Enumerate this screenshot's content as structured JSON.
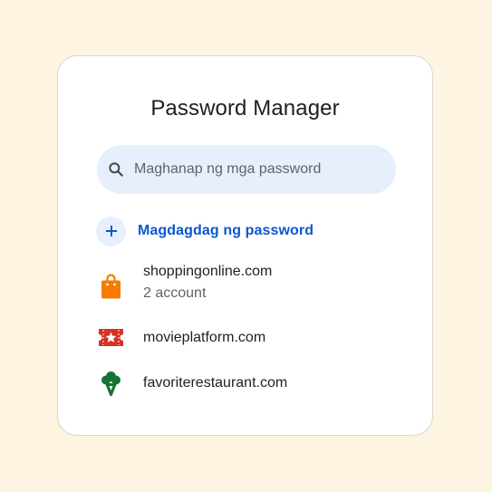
{
  "header": {
    "title": "Password Manager"
  },
  "search": {
    "placeholder": "Maghanap ng mga password",
    "value": ""
  },
  "add_password": {
    "label": "Magdagdag ng password"
  },
  "passwords": [
    {
      "site": "shoppingonline.com",
      "detail": "2 account",
      "icon": "shopping-bag-icon",
      "color": "#f57c00"
    },
    {
      "site": "movieplatform.com",
      "icon": "movie-ticket-icon",
      "color": "#d93025"
    },
    {
      "site": "favoriterestaurant.com",
      "icon": "broccoli-icon",
      "color": "#137333"
    }
  ],
  "colors": {
    "page_background": "#fdf4e1",
    "card_background": "#ffffff",
    "accent": "#0b57d0",
    "search_background": "#e8effc"
  }
}
